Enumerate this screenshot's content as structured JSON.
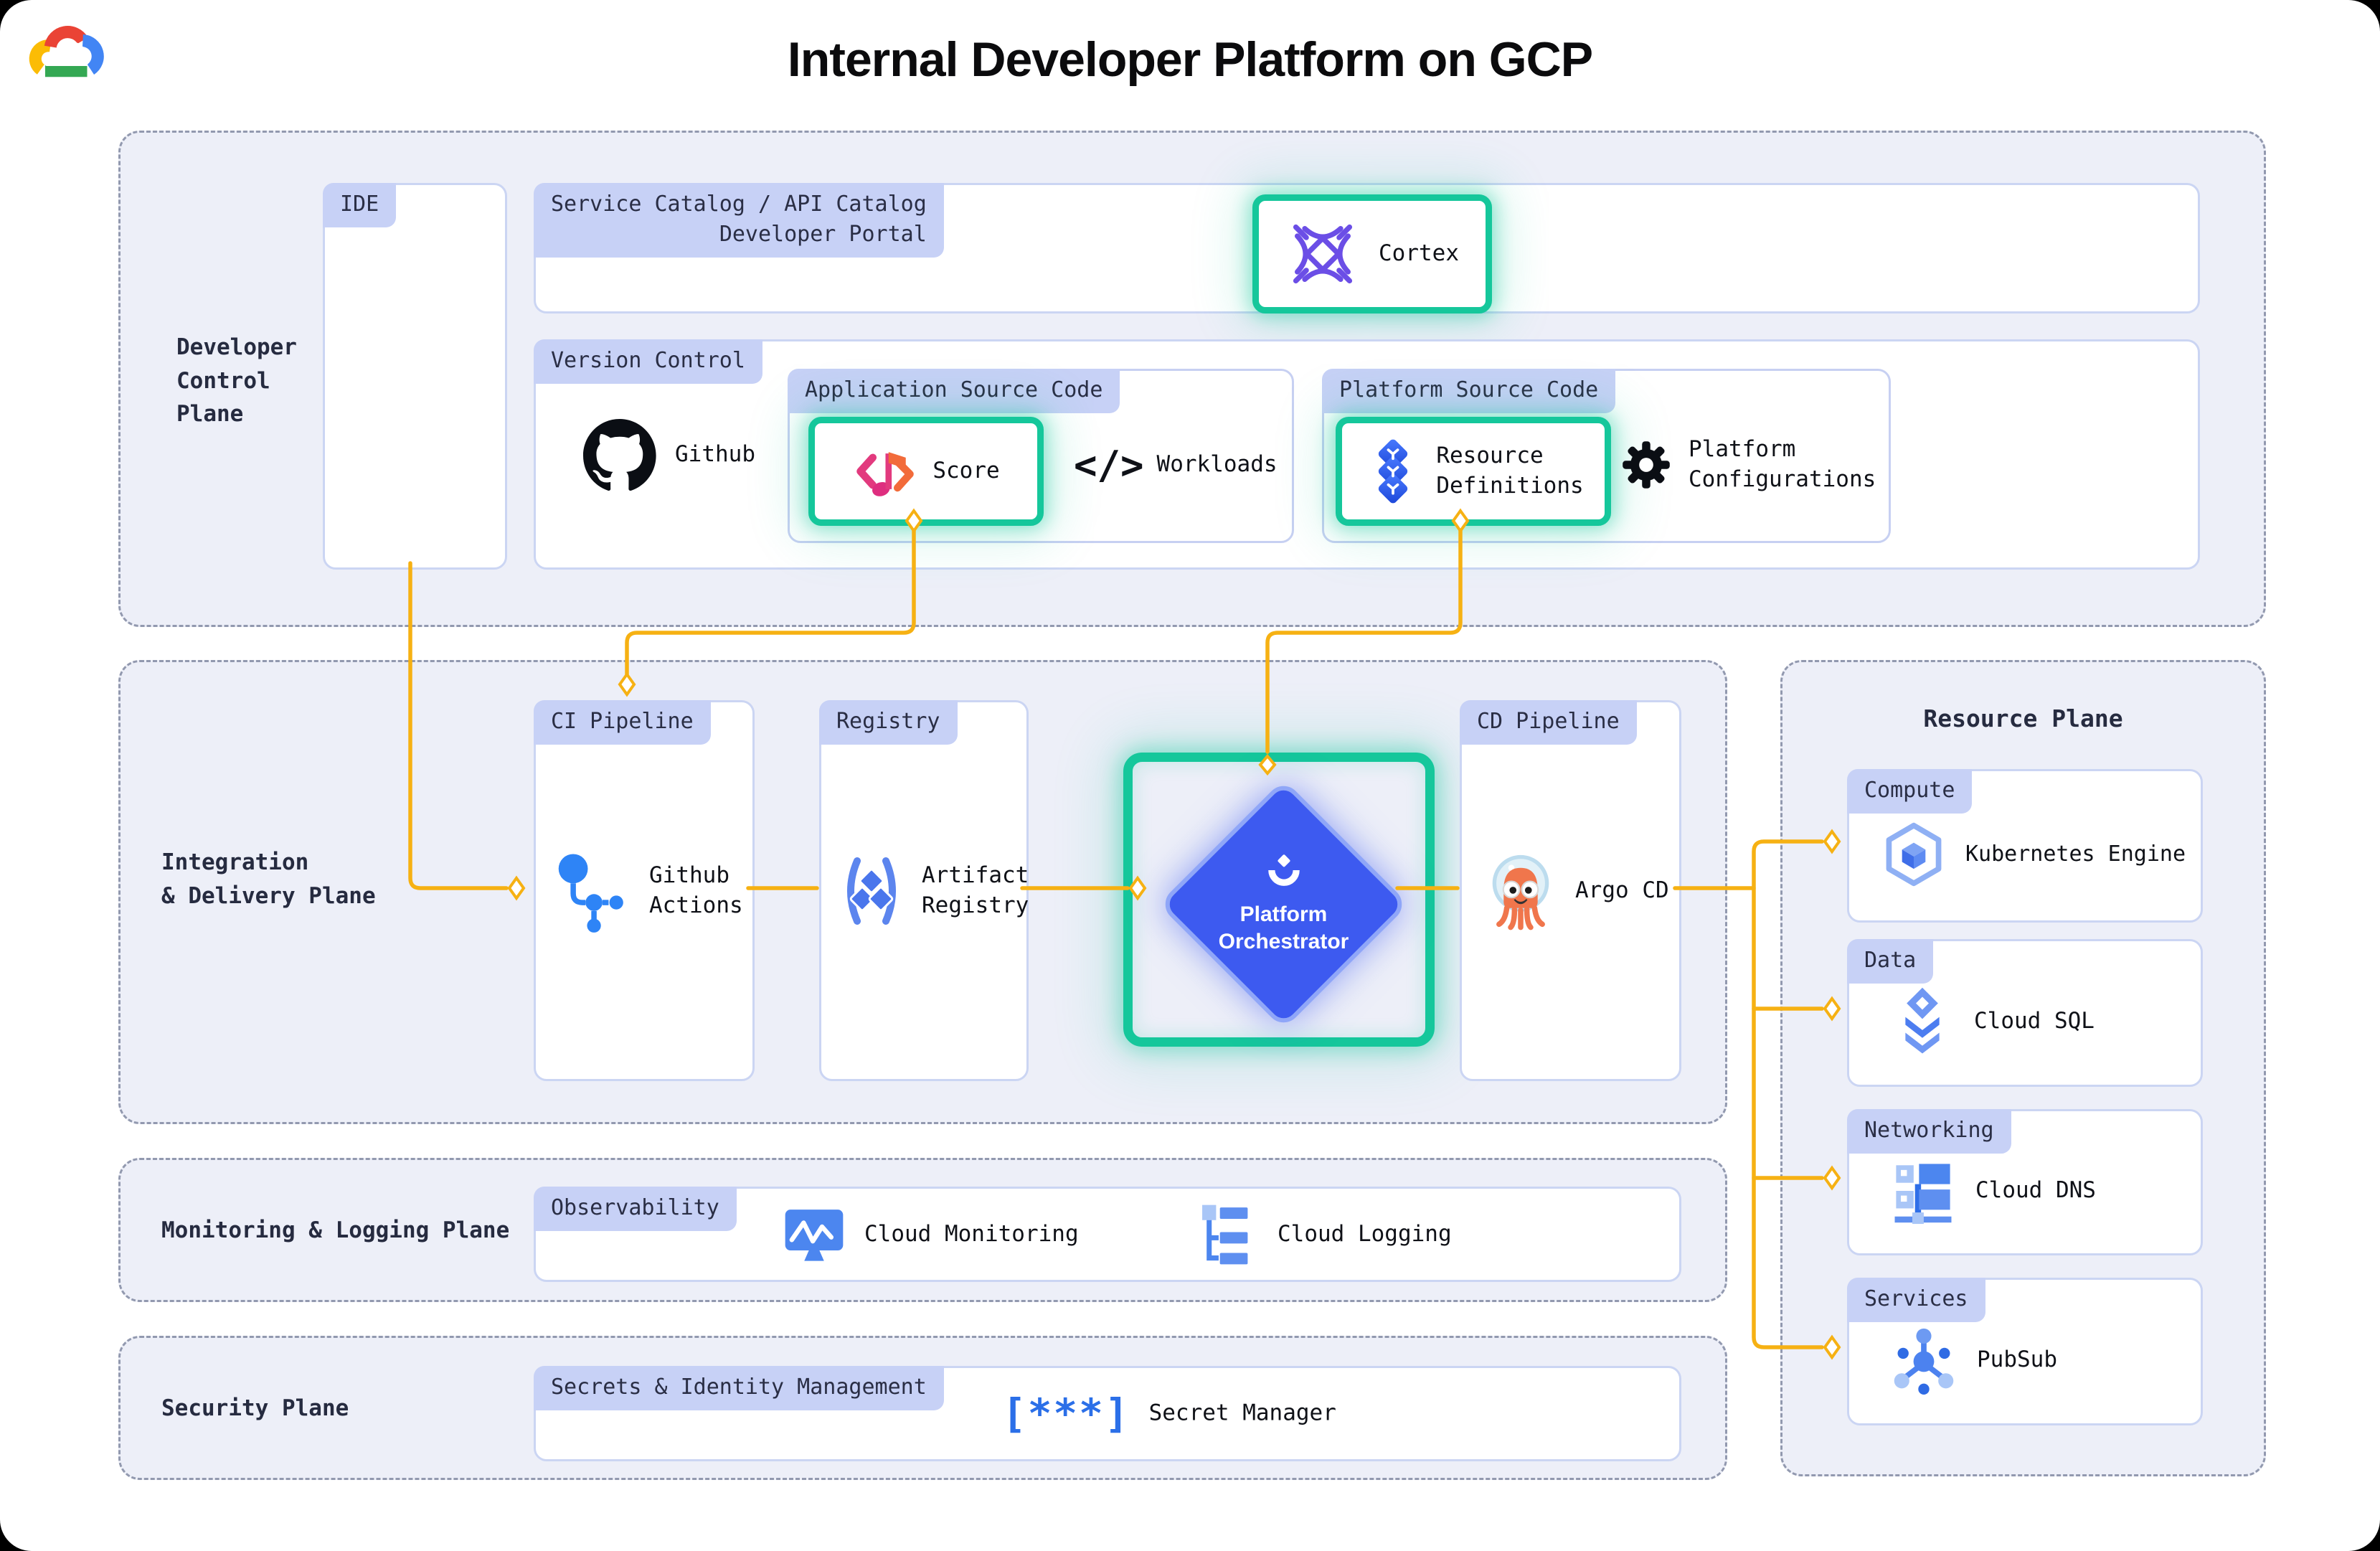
{
  "title": "Internal Developer Platform on GCP",
  "planes": {
    "developer_control": "Developer\nControl\nPlane",
    "integration_delivery": "Integration\n& Delivery Plane",
    "monitoring_logging": "Monitoring & Logging Plane",
    "security": "Security Plane",
    "resource": "Resource Plane"
  },
  "chips": {
    "ide": "IDE",
    "service_catalog": "Service Catalog / API Catalog\nDeveloper Portal",
    "version_control": "Version Control",
    "application_source_code": "Application Source Code",
    "platform_source_code": "Platform Source Code",
    "ci_pipeline": "CI Pipeline",
    "registry": "Registry",
    "cd_pipeline": "CD Pipeline",
    "observability": "Observability",
    "secrets_identity": "Secrets & Identity Management",
    "compute": "Compute",
    "data": "Data",
    "networking": "Networking",
    "services": "Services"
  },
  "items": {
    "cortex": "Cortex",
    "github": "Github",
    "score": "Score",
    "workloads": "Workloads",
    "code_glyph": "</>",
    "resource_definitions": "Resource\nDefinitions",
    "platform_configurations": "Platform\nConfigurations",
    "github_actions": "Github\nActions",
    "artifact_registry": "Artifact\nRegistry",
    "platform_orchestrator": "Platform\nOrchestrator",
    "argo_cd": "Argo CD",
    "kubernetes_engine": "Kubernetes Engine",
    "cloud_sql": "Cloud SQL",
    "cloud_dns": "Cloud DNS",
    "pubsub": "PubSub",
    "cloud_monitoring": "Cloud Monitoring",
    "cloud_logging": "Cloud Logging",
    "secret_manager": "Secret Manager",
    "secret_glyph": "[***]"
  },
  "colors": {
    "highlight_teal": "#15c79b",
    "connector_yellow": "#f6b113",
    "orchestrator_blue": "#3d5af0",
    "chip_lavender": "#c7d1f6",
    "plane_background": "#edeff8",
    "icon_blue": "#4c86ef"
  }
}
